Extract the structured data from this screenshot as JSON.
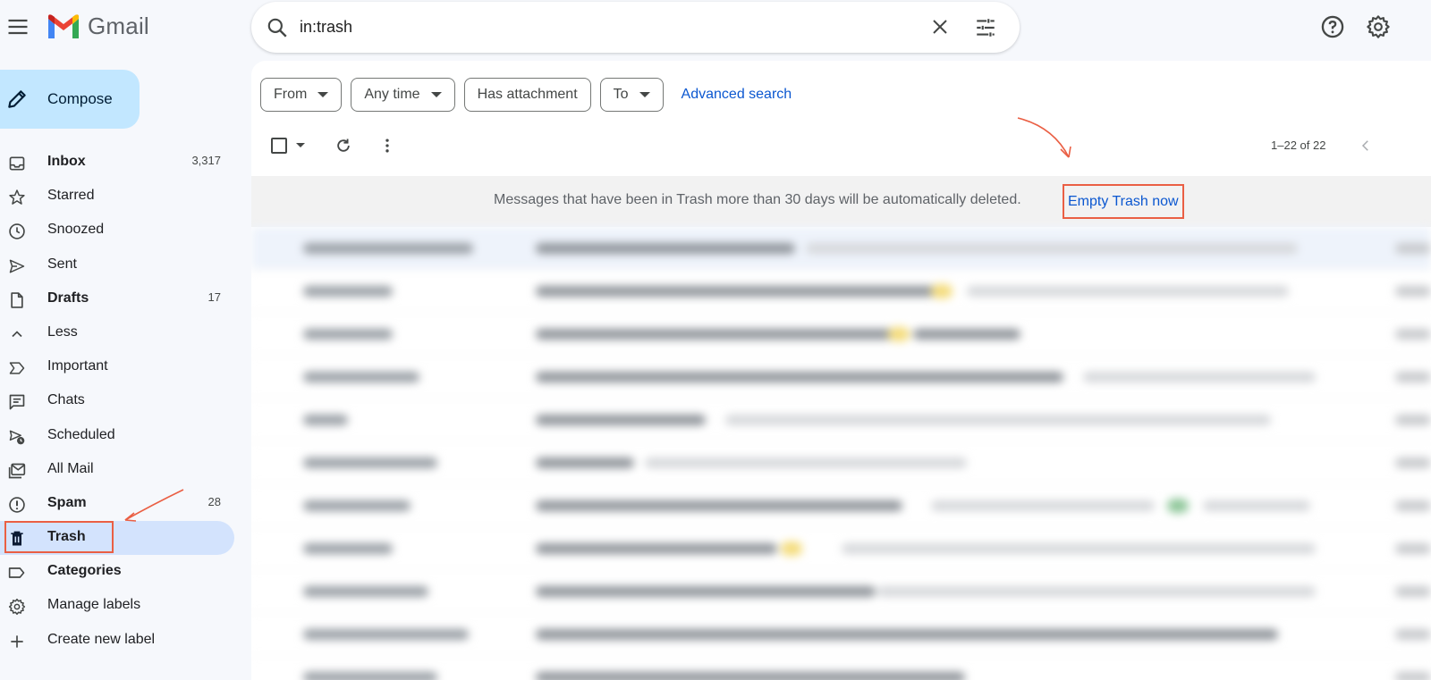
{
  "app": {
    "name": "Gmail",
    "logo_colors": [
      "#4285F4",
      "#EA4335",
      "#FBBC04",
      "#34A853",
      "#C5221F"
    ]
  },
  "search": {
    "value": "in:trash"
  },
  "header_icons": [
    "menu-icon",
    "search-icon",
    "clear-icon",
    "tune-icon",
    "help-icon",
    "settings-icon"
  ],
  "compose": {
    "label": "Compose"
  },
  "sidebar": {
    "items": [
      {
        "label": "Inbox",
        "count": "3,317",
        "bold": true,
        "icon": "inbox-icon"
      },
      {
        "label": "Starred",
        "count": "",
        "bold": false,
        "icon": "star-icon"
      },
      {
        "label": "Snoozed",
        "count": "",
        "bold": false,
        "icon": "clock-icon"
      },
      {
        "label": "Sent",
        "count": "",
        "bold": false,
        "icon": "send-icon"
      },
      {
        "label": "Drafts",
        "count": "17",
        "bold": true,
        "icon": "draft-icon"
      },
      {
        "label": "Less",
        "count": "",
        "bold": false,
        "icon": "chevron-up-icon"
      },
      {
        "label": "Important",
        "count": "",
        "bold": false,
        "icon": "important-icon"
      },
      {
        "label": "Chats",
        "count": "",
        "bold": false,
        "icon": "chat-icon"
      },
      {
        "label": "Scheduled",
        "count": "",
        "bold": false,
        "icon": "scheduled-icon"
      },
      {
        "label": "All Mail",
        "count": "",
        "bold": false,
        "icon": "all-mail-icon"
      },
      {
        "label": "Spam",
        "count": "28",
        "bold": true,
        "icon": "spam-icon"
      },
      {
        "label": "Trash",
        "count": "",
        "bold": true,
        "icon": "trash-icon",
        "active": true
      },
      {
        "label": "Categories",
        "count": "",
        "bold": true,
        "icon": "label-icon"
      },
      {
        "label": "Manage labels",
        "count": "",
        "bold": false,
        "icon": "gear-icon"
      },
      {
        "label": "Create new label",
        "count": "",
        "bold": false,
        "icon": "plus-icon"
      }
    ]
  },
  "filters": {
    "chips": [
      {
        "label": "From",
        "dropdown": true
      },
      {
        "label": "Any time",
        "dropdown": true
      },
      {
        "label": "Has attachment",
        "dropdown": false
      },
      {
        "label": "To",
        "dropdown": true
      }
    ],
    "advanced_label": "Advanced search"
  },
  "toolbar": {
    "range": "1–22 of 22"
  },
  "banner": {
    "text": "Messages that have been in Trash more than 30 days will be automatically deleted.",
    "action": "Empty Trash now"
  },
  "colors": {
    "accent": "#0b57d0",
    "compose_bg": "#c2e7ff",
    "active_nav_bg": "#d3e3fd",
    "annotation": "#ea5f44"
  }
}
